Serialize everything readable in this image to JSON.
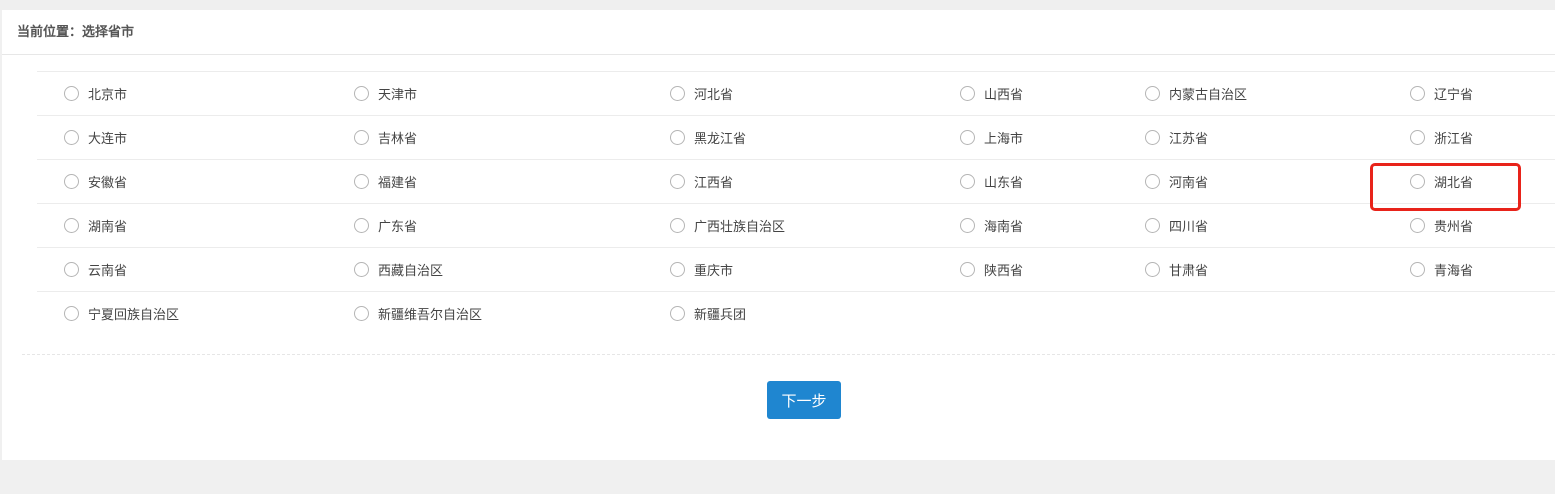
{
  "breadcrumb": {
    "text": "当前位置：选择省市"
  },
  "regions": [
    [
      "北京市",
      "天津市",
      "河北省",
      "山西省",
      "内蒙古自治区",
      "辽宁省"
    ],
    [
      "大连市",
      "吉林省",
      "黑龙江省",
      "上海市",
      "江苏省",
      "浙江省"
    ],
    [
      "安徽省",
      "福建省",
      "江西省",
      "山东省",
      "河南省",
      "湖北省"
    ],
    [
      "湖南省",
      "广东省",
      "广西壮族自治区",
      "海南省",
      "四川省",
      "贵州省"
    ],
    [
      "云南省",
      "西藏自治区",
      "重庆市",
      "陕西省",
      "甘肃省",
      "青海省"
    ],
    [
      "宁夏回族自治区",
      "新疆维吾尔自治区",
      "新疆兵团"
    ]
  ],
  "next_button": {
    "label": "下一步"
  },
  "highlighted_region": "湖北省",
  "colors": {
    "primary": "#1f86d0",
    "highlight": "#e8231a"
  }
}
